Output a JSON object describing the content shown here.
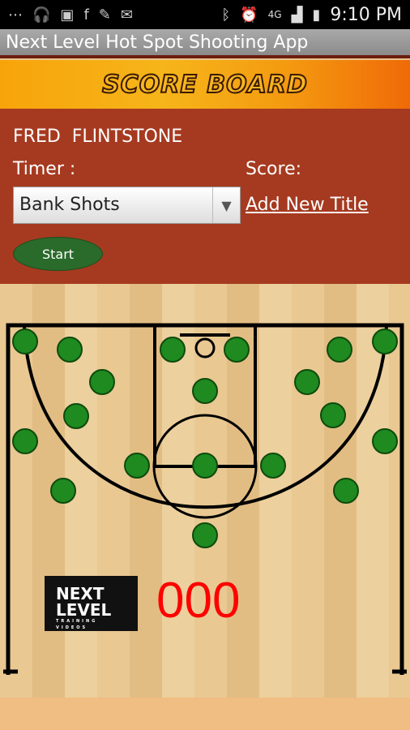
{
  "status_bar": {
    "time": "9:10 PM",
    "icons": [
      "more-icon",
      "headset-icon",
      "media-icon",
      "facebook-icon",
      "cleaner-icon",
      "gmail-icon",
      "bluetooth-icon",
      "alarm-icon",
      "4g-icon",
      "signal-icon",
      "battery-icon"
    ]
  },
  "app": {
    "title": "Next Level Hot Spot Shooting App",
    "banner": "SCORE BOARD"
  },
  "panel": {
    "player_name": "FRED  FLINTSTONE",
    "timer_label": "Timer :",
    "score_label": "Score:",
    "shot_type": "Bank Shots",
    "add_title_link": "Add New Title",
    "start_button": "Start"
  },
  "court": {
    "spot_color": "#1f8a1f",
    "spot_count": 19,
    "score": "000",
    "logo_text": [
      "NEXT",
      "LEVEL",
      "TRAINING VIDEOS"
    ]
  }
}
